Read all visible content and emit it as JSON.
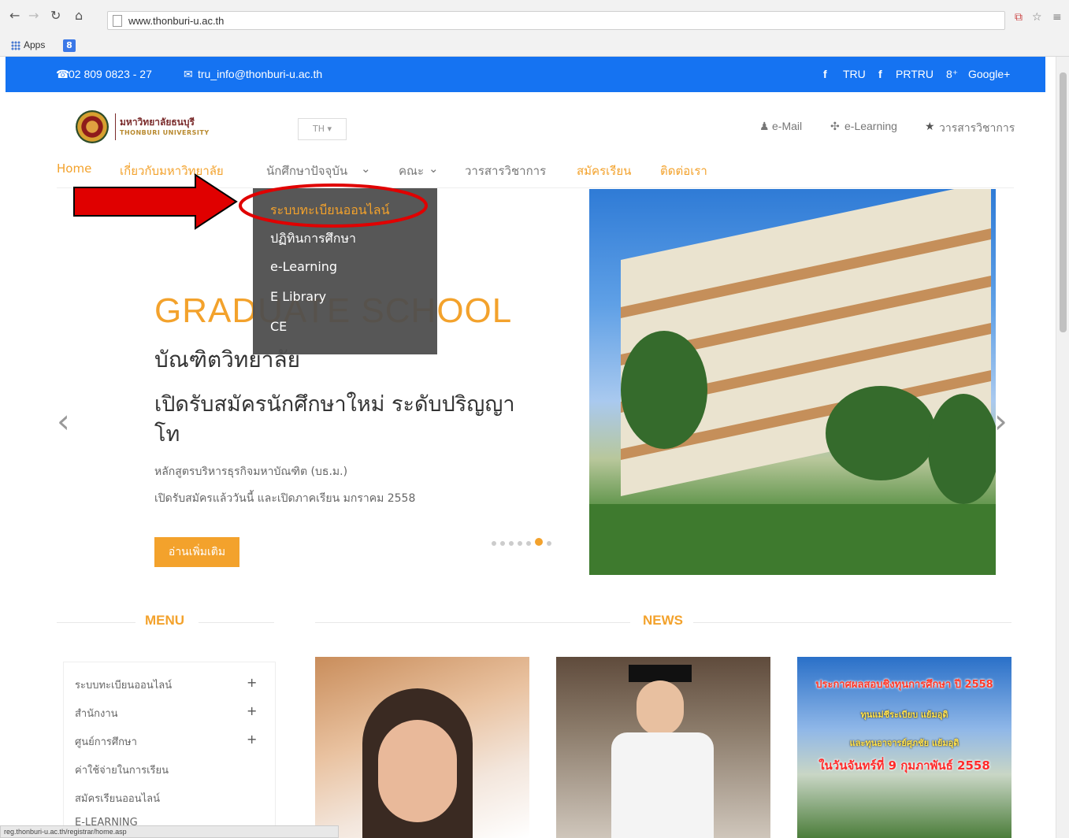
{
  "browser": {
    "url": "www.thonburi-u.ac.th",
    "bookmarks": {
      "apps_label": "Apps",
      "favicon_letter": "8"
    },
    "status_url": "reg.thonburi-u.ac.th/registrar/home.asp"
  },
  "topbar": {
    "phone": "02 809 0823 - 27",
    "email": "tru_info@thonburi-u.ac.th",
    "social": [
      "TRU",
      "PRTRU",
      "Google+"
    ]
  },
  "header": {
    "logo_th": "มหาวิทยาลัยธนบุรี",
    "logo_en": "THONBURI UNIVERSITY",
    "lang": "TH",
    "utility": [
      "e-Mail",
      "e-Learning",
      "วารสารวิชาการ"
    ]
  },
  "nav": {
    "items": [
      "Home",
      "เกี่ยวกับมหาวิทยาลัย",
      "นักศึกษาปัจจุบัน",
      "คณะ",
      "วารสารวิชาการ",
      "สมัครเรียน",
      "ติดต่อเรา"
    ]
  },
  "dropdown": {
    "items": [
      "ระบบทะเบียนออนไลน์",
      "ปฏิทินการศึกษา",
      "e-Learning",
      "E Library",
      "CE"
    ]
  },
  "hero": {
    "kicker": "GRADUATE SCHOOL",
    "subtitle": "บัณฑิตวิทยาลัย",
    "title": "เปิดรับสมัครนักศึกษาใหม่ ระดับปริญญาโท",
    "desc1": "หลักสูตรบริหารธุรกิจมหาบัณฑิต (บธ.ม.)",
    "desc2": "เปิดรับสมัครแล้ววันนี้ และเปิดภาคเรียน มกราคม 2558",
    "button": "อ่านเพิ่มเติม",
    "slides_total": 7,
    "slides_active_index": 5
  },
  "menu": {
    "title": "MENU",
    "items": [
      "ระบบทะเบียนออนไลน์",
      "สำนักงาน",
      "ศูนย์การศึกษา",
      "ค่าใช้จ่ายในการเรียน",
      "สมัครเรียนออนไลน์",
      "E-LEARNING"
    ]
  },
  "news": {
    "title": "NEWS",
    "card3": {
      "line1": "ประกาศผลสอบชิงทุนการศึกษา ปี 2558",
      "line2": "ทุนแม่ชีระเบียบ แย้มอุดิ",
      "line3": "และทุนอาจารย์ศุภชัย แย้มอุดิ",
      "line4": "ในวันจันทร์ที่ 9 กุมภาพันธ์ 2558"
    }
  },
  "colors": {
    "accent": "#f3a22c",
    "topbar": "#1573f2",
    "dropdown_bg": "#4e4e4e",
    "annotation": "#e00000"
  }
}
